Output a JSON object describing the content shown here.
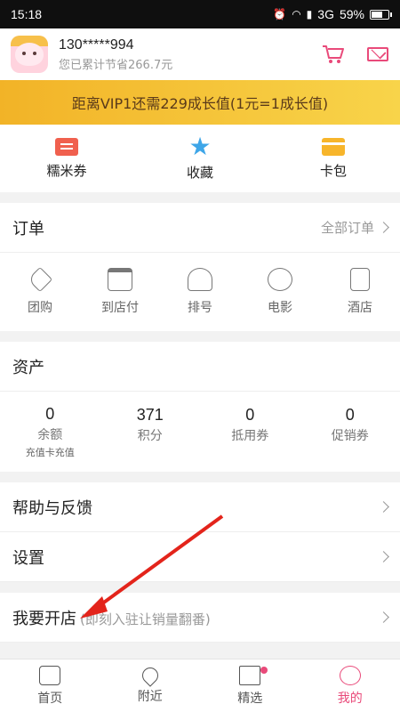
{
  "status_bar": {
    "time": "15:18",
    "network": "3G",
    "battery_pct": "59%",
    "battery_level": 0.59
  },
  "profile": {
    "phone": "130*****994",
    "saved_text": "您已累计节省266.7元"
  },
  "vip_banner": {
    "text": "距离VIP1还需229成长值(1元=1成长值)"
  },
  "quick_actions": [
    {
      "label": "糯米券",
      "icon": "ticket-icon"
    },
    {
      "label": "收藏",
      "icon": "star-icon"
    },
    {
      "label": "卡包",
      "icon": "card-icon"
    }
  ],
  "orders": {
    "title": "订单",
    "all_orders": "全部订单",
    "items": [
      {
        "label": "团购",
        "icon": "tag-icon"
      },
      {
        "label": "到店付",
        "icon": "shop-icon"
      },
      {
        "label": "排号",
        "icon": "people-icon"
      },
      {
        "label": "电影",
        "icon": "film-icon"
      },
      {
        "label": "酒店",
        "icon": "hotel-icon"
      }
    ]
  },
  "assets": {
    "title": "资产",
    "items": [
      {
        "value": "0",
        "label": "余额",
        "sub": "充值卡充值"
      },
      {
        "value": "371",
        "label": "积分",
        "sub": ""
      },
      {
        "value": "0",
        "label": "抵用券",
        "sub": ""
      },
      {
        "value": "0",
        "label": "促销券",
        "sub": ""
      }
    ]
  },
  "menu": {
    "help": "帮助与反馈",
    "settings": "设置",
    "open_store": "我要开店",
    "open_store_sub": "(即刻入驻让销量翻番)"
  },
  "tabbar": [
    {
      "label": "首页",
      "icon": "home-icon"
    },
    {
      "label": "附近",
      "icon": "location-icon"
    },
    {
      "label": "精选",
      "icon": "bag-icon"
    },
    {
      "label": "我的",
      "icon": "user-icon"
    }
  ],
  "colors": {
    "accent": "#e94a7a",
    "vip": "#f2b327",
    "star": "#3ea6e8"
  }
}
